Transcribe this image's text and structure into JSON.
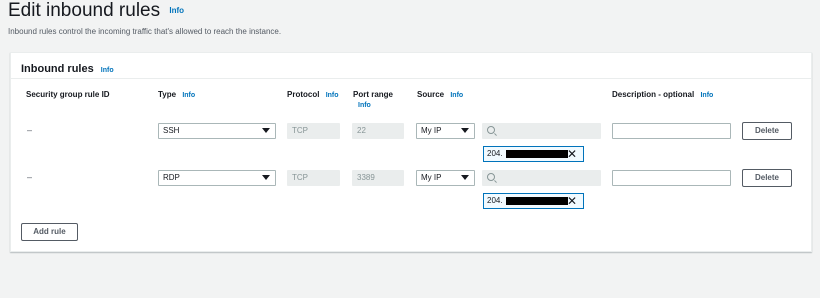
{
  "page": {
    "title": "Edit inbound rules",
    "title_info": "Info",
    "description": "Inbound rules control the incoming traffic that's allowed to reach the instance."
  },
  "panel": {
    "title": "Inbound rules",
    "title_info": "Info"
  },
  "columns": {
    "rule_id": "Security group rule ID",
    "type": "Type",
    "type_info": "Info",
    "protocol": "Protocol",
    "protocol_info": "Info",
    "port_range": "Port range",
    "port_range_info": "Info",
    "source": "Source",
    "source_info": "Info",
    "description": "Description - optional",
    "description_info": "Info"
  },
  "rules": [
    {
      "rule_id": "–",
      "type": "SSH",
      "protocol": "TCP",
      "port_range": "22",
      "source": "My IP",
      "source_search_placeholder": "",
      "source_token": "204.",
      "description": "",
      "delete_label": "Delete"
    },
    {
      "rule_id": "–",
      "type": "RDP",
      "protocol": "TCP",
      "port_range": "3389",
      "source": "My IP",
      "source_search_placeholder": "",
      "source_token": "204.",
      "description": "",
      "delete_label": "Delete"
    }
  ],
  "add_rule_label": "Add rule",
  "colors": {
    "link": "#0073bb",
    "background": "#f2f3f3",
    "disabled_field": "#eaeded",
    "token_border": "#0073bb"
  },
  "icons": {
    "select": "chevron-down-icon",
    "search": "search-icon",
    "remove_token": "close-icon"
  }
}
